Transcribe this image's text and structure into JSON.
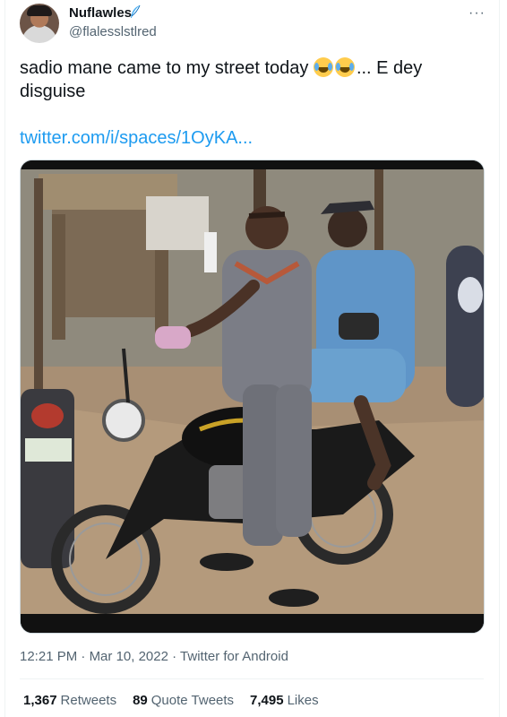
{
  "author": {
    "display_name": "Nuflawles",
    "handle": "@flalesslstlred",
    "verified_icon": "feather-icon",
    "avatar": "user-avatar"
  },
  "more_icon": "ellipsis-icon",
  "tweet": {
    "text_main": "sadio mane came to my street today",
    "emoji": "face-with-tears-of-joy",
    "text_after": "... E dey disguise",
    "link": "twitter.com/i/spaces/1OyKA...",
    "media_alt": "photo of a man riding a motorcycle with a woman passenger"
  },
  "meta": {
    "time": "12:21 PM",
    "date": "Mar 10, 2022",
    "source": "Twitter for Android",
    "separator": "·"
  },
  "stats": {
    "retweets_count": "1,367",
    "retweets_label": "Retweets",
    "quotes_count": "89",
    "quotes_label": "Quote Tweets",
    "likes_count": "7,495",
    "likes_label": "Likes"
  },
  "colors": {
    "link": "#1d9bf0",
    "secondary_text": "#536471",
    "text": "#0f1419"
  }
}
